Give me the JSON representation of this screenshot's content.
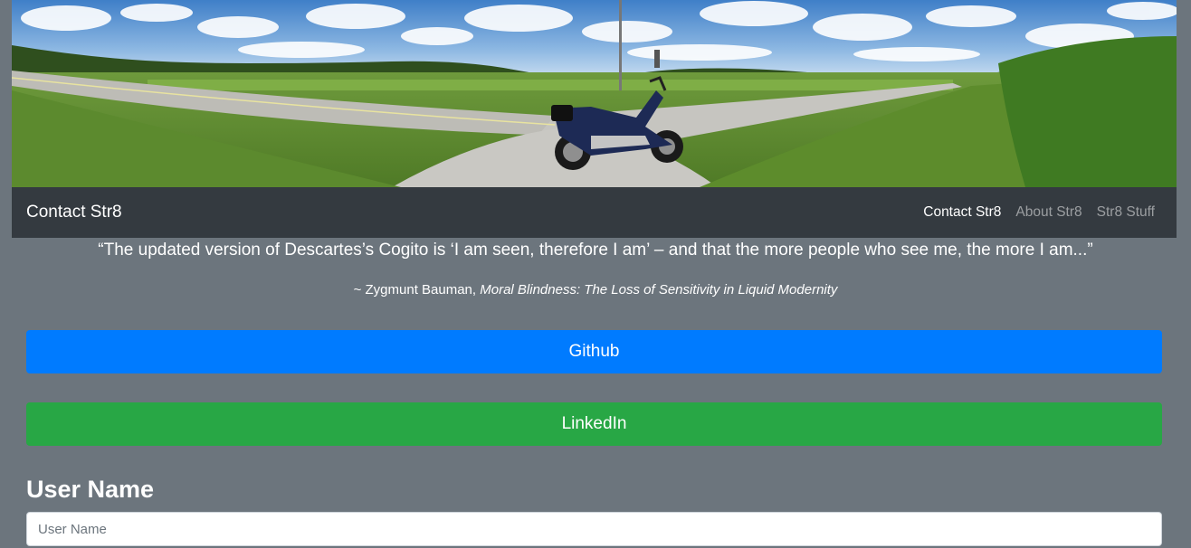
{
  "banner": {
    "image": "panoramic-road-motorcycle-photo"
  },
  "navbar": {
    "brand": "Contact Str8",
    "links": [
      {
        "label": "Contact Str8",
        "active": true
      },
      {
        "label": "About Str8",
        "active": false
      },
      {
        "label": "Str8 Stuff",
        "active": false
      }
    ]
  },
  "quote": {
    "text": "“The updated version of Descartes’s Cogito is ‘I am seen, therefore I am’ – and that the more people who see me, the more I am...”",
    "author": "~ Zygmunt Bauman, ",
    "book": "Moral Blindness: The Loss of Sensitivity in Liquid Modernity"
  },
  "buttons": {
    "github": "Github",
    "linkedin": "LinkedIn"
  },
  "form": {
    "username_label": "User Name",
    "username_placeholder": "User Name",
    "username_value": ""
  },
  "colors": {
    "page_bg": "#6c757d",
    "navbar_bg": "#343a40",
    "github_button": "#007bff",
    "linkedin_button": "#28a745"
  }
}
